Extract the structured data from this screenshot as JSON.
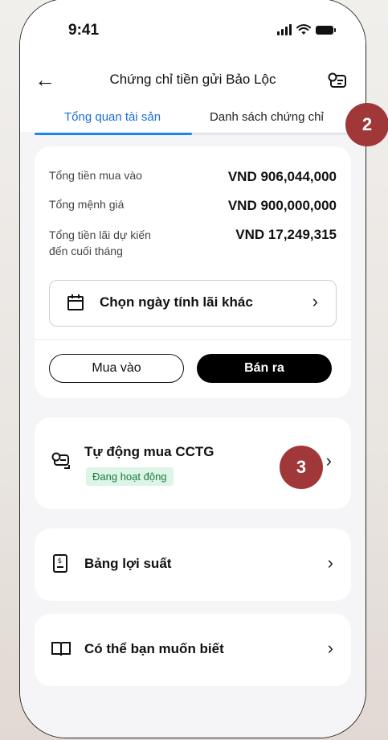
{
  "status": {
    "time": "9:41"
  },
  "header": {
    "title": "Chứng chỉ tiền gửi Bảo Lộc"
  },
  "tabs": [
    {
      "label": "Tổng quan tài sản"
    },
    {
      "label": "Danh sách chứng chỉ"
    }
  ],
  "summary": {
    "rows": [
      {
        "label": "Tổng tiền mua vào",
        "value": "VND 906,044,000"
      },
      {
        "label": "Tổng mệnh giá",
        "value": "VND 900,000,000"
      },
      {
        "label_line1": "Tổng tiền lãi dự kiến",
        "label_line2": "đến cuối tháng",
        "value": "VND 17,249,315"
      }
    ],
    "date_button": "Chọn ngày tính lãi khác",
    "buy": "Mua vào",
    "sell": "Bán ra"
  },
  "auto_buy": {
    "title": "Tự động mua CCTG",
    "status": "Đang hoạt động"
  },
  "links": [
    {
      "label": "Bảng lợi suất"
    },
    {
      "label": "Có thể bạn muốn biết"
    }
  ],
  "steps": [
    "2",
    "3"
  ]
}
